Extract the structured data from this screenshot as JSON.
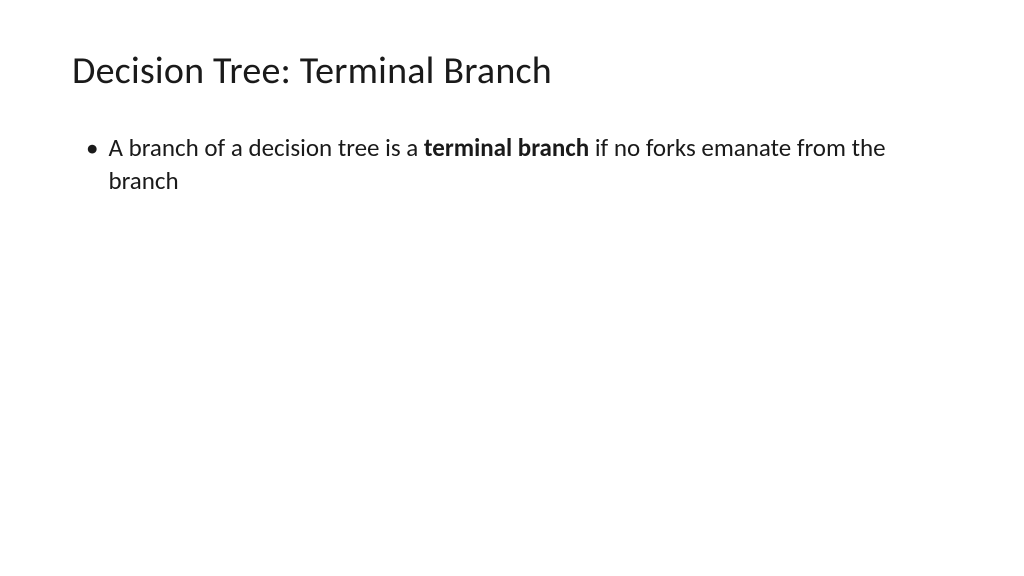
{
  "slide": {
    "title": "Decision Tree: Terminal Branch",
    "bullet": {
      "part1": "A branch of a decision tree is a ",
      "bold": "terminal branch",
      "part2": " if no forks emanate from the branch"
    }
  }
}
